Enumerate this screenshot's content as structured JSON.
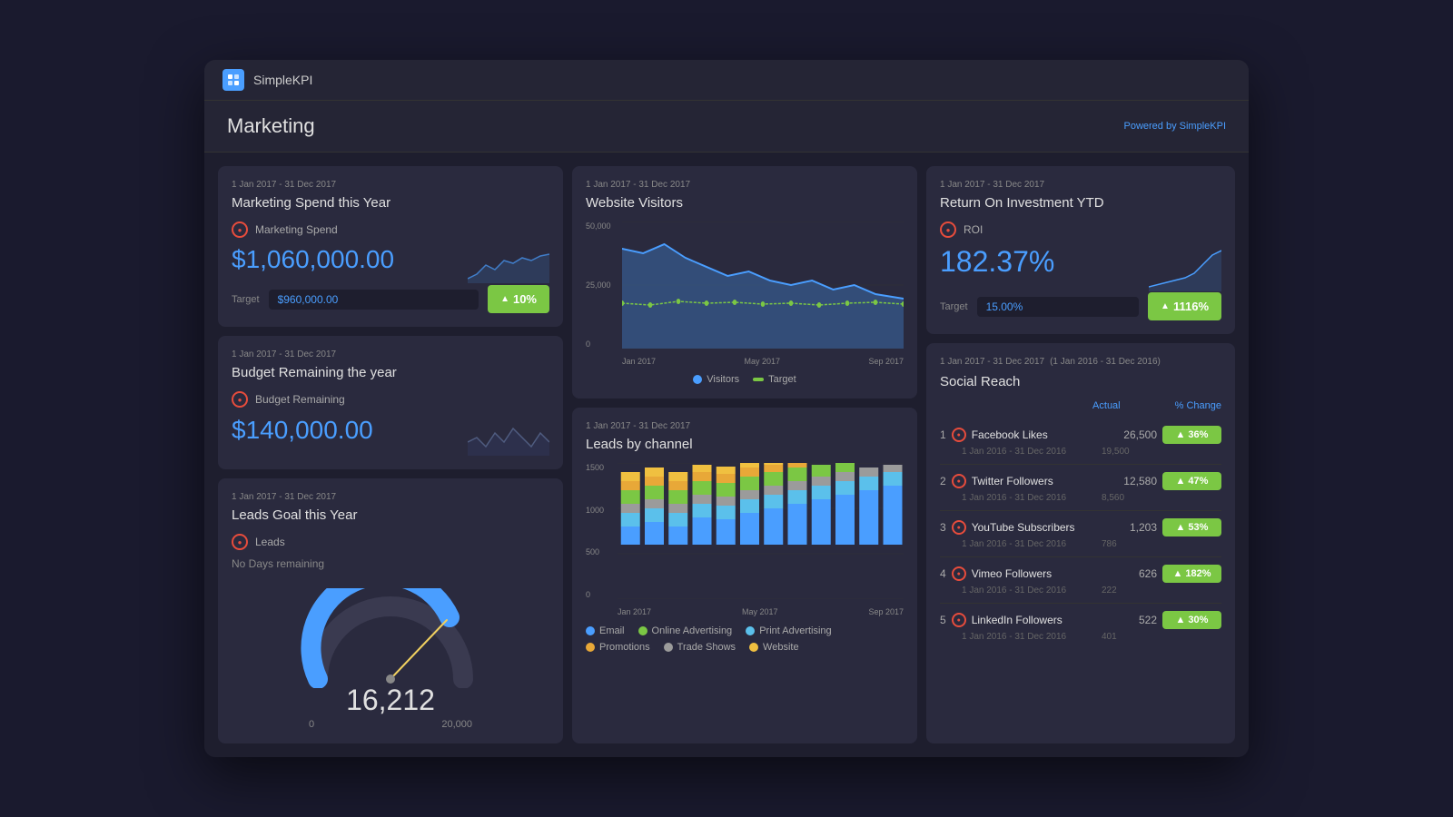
{
  "app": {
    "title": "SimpleKPI",
    "poweredBy": "Powered by ",
    "poweredByBrand": "SimpleKPI"
  },
  "page": {
    "title": "Marketing"
  },
  "cards": {
    "marketing_spend": {
      "date": "1 Jan 2017 - 31 Dec 2017",
      "title": "Marketing Spend this Year",
      "metric_label": "Marketing Spend",
      "value": "$1,060,000.00",
      "target_label": "Target",
      "target_value": "$960,000.00",
      "badge": "10%"
    },
    "budget_remaining": {
      "date": "1 Jan 2017 - 31 Dec 2017",
      "title": "Budget Remaining the year",
      "metric_label": "Budget Remaining",
      "value": "$140,000.00"
    },
    "leads_goal": {
      "date": "1 Jan 2017 - 31 Dec 2017",
      "title": "Leads Goal this Year",
      "metric_label": "Leads",
      "no_days": "No Days remaining",
      "gauge_value": "16,212",
      "gauge_min": "0",
      "gauge_max": "20,000"
    },
    "website_visitors": {
      "date": "1 Jan 2017 - 31 Dec 2017",
      "title": "Website Visitors",
      "y_labels": [
        "50,000",
        "25,000",
        "0"
      ],
      "x_labels": [
        "Jan 2017",
        "May 2017",
        "Sep 2017"
      ],
      "legend": [
        {
          "label": "Visitors",
          "color": "#4a9eff"
        },
        {
          "label": "Target",
          "color": "#7bc744"
        }
      ]
    },
    "leads_by_channel": {
      "date": "1 Jan 2017 - 31 Dec 2017",
      "title": "Leads by channel",
      "x_labels": [
        "Jan 2017",
        "May 2017",
        "Sep 2017"
      ],
      "y_labels": [
        "1500",
        "1000",
        "500",
        "0"
      ],
      "legend": [
        {
          "label": "Email",
          "color": "#4a9eff"
        },
        {
          "label": "Online Advertising",
          "color": "#7bc744"
        },
        {
          "label": "Print Advertising",
          "color": "#5bc0eb"
        },
        {
          "label": "Promotions",
          "color": "#e8a838"
        },
        {
          "label": "Trade Shows",
          "color": "#9b9b9b"
        },
        {
          "label": "Website",
          "color": "#f0c040"
        }
      ]
    },
    "roi": {
      "date": "1 Jan 2017 - 31 Dec 2017",
      "title": "Return On Investment YTD",
      "metric_label": "ROI",
      "value": "182.37%",
      "target_label": "Target",
      "target_value": "15.00%",
      "badge": "1116%"
    },
    "social_reach": {
      "date": "1 Jan 2017 - 31 Dec 2017",
      "date2": "(1 Jan 2016 - 31 Dec 2016)",
      "title": "Social Reach",
      "col_actual": "Actual",
      "col_change": "% Change",
      "items": [
        {
          "rank": "1",
          "name": "Facebook Likes",
          "actual": "26,500",
          "prev": "19,500",
          "prev_date": "1 Jan 2016 - 31 Dec 2016",
          "change": "36%"
        },
        {
          "rank": "2",
          "name": "Twitter Followers",
          "actual": "12,580",
          "prev": "8,560",
          "prev_date": "1 Jan 2016 - 31 Dec 2016",
          "change": "47%"
        },
        {
          "rank": "3",
          "name": "YouTube Subscribers",
          "actual": "1,203",
          "prev": "786",
          "prev_date": "1 Jan 2016 - 31 Dec 2016",
          "change": "53%"
        },
        {
          "rank": "4",
          "name": "Vimeo Followers",
          "actual": "626",
          "prev": "222",
          "prev_date": "1 Jan 2016 - 31 Dec 2016",
          "change": "182%"
        },
        {
          "rank": "5",
          "name": "LinkedIn Followers",
          "actual": "522",
          "prev": "401",
          "prev_date": "1 Jan 2016 - 31 Dec 2016",
          "change": "30%"
        }
      ]
    }
  }
}
